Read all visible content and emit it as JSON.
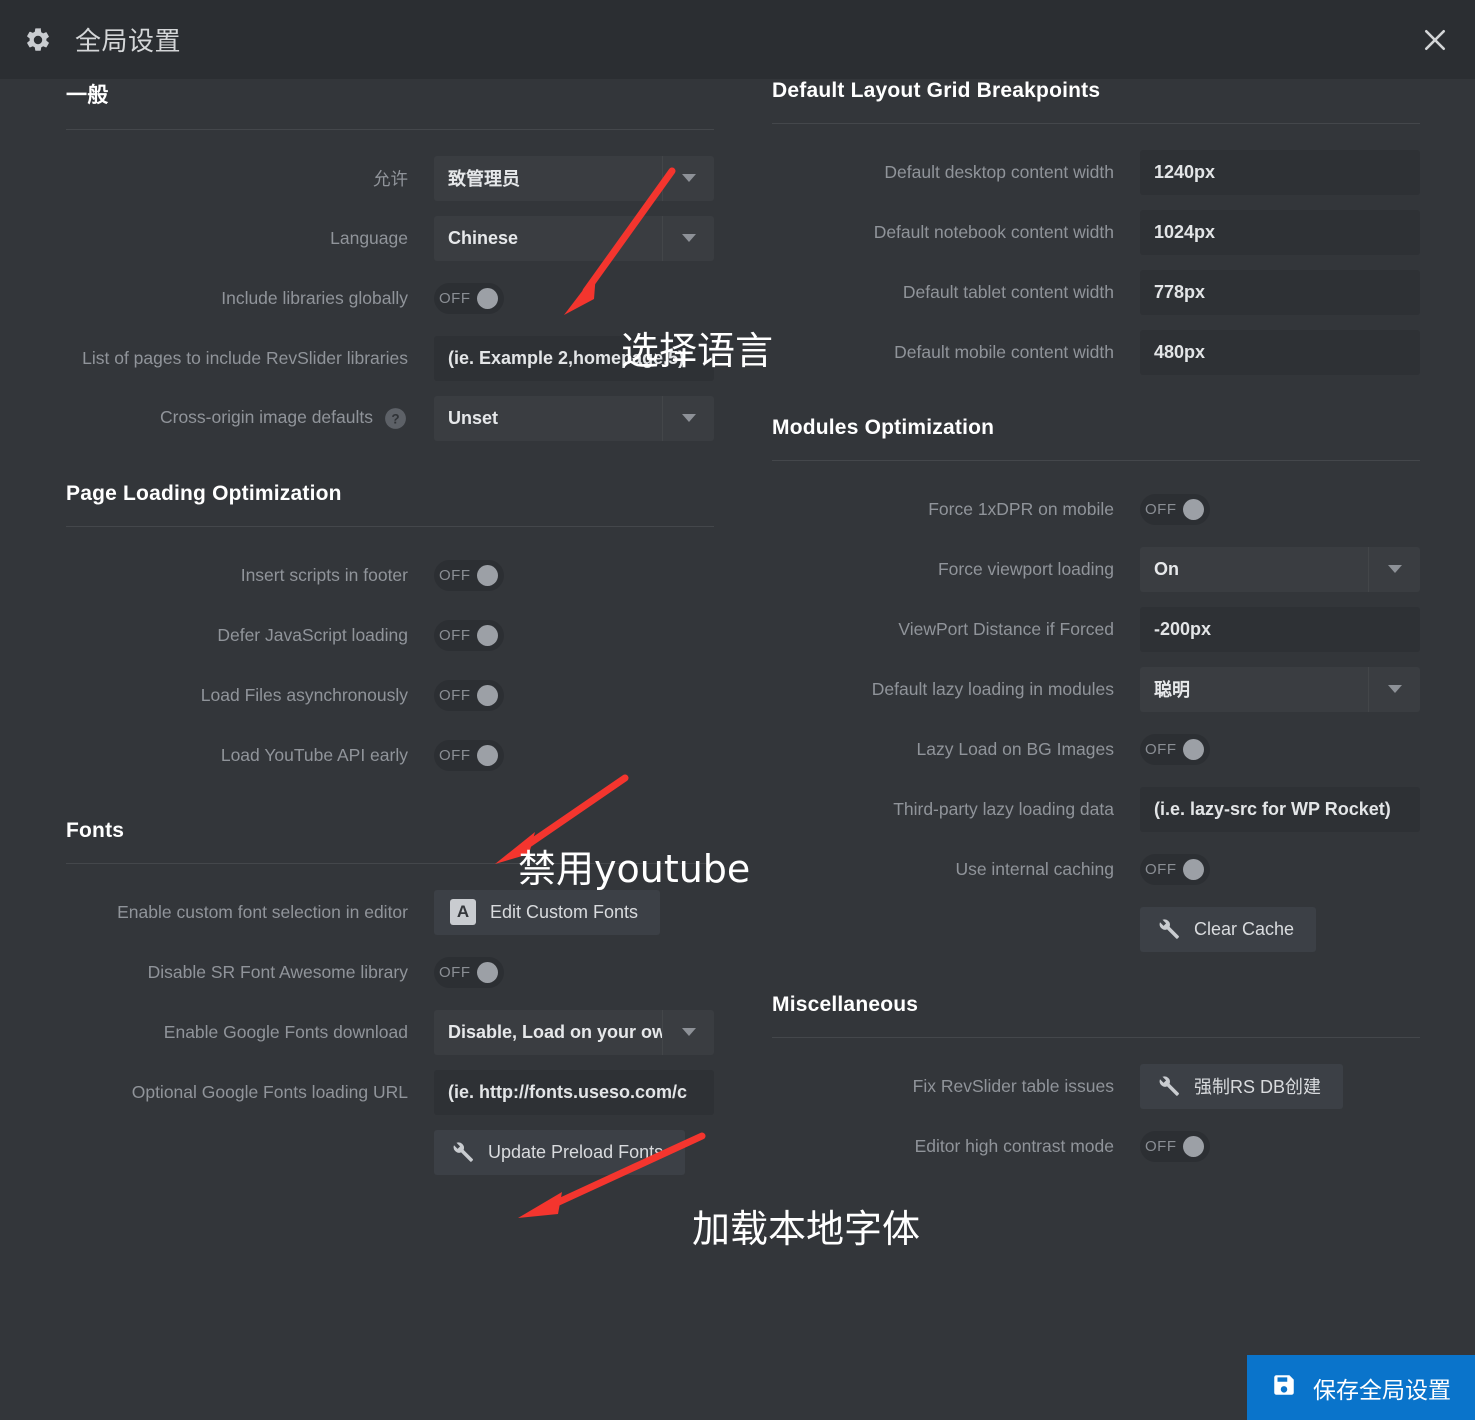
{
  "header": {
    "title": "全局设置",
    "gear_icon": "gear-icon",
    "close_icon": "close-icon"
  },
  "colors": {
    "accent": "#0a74cb",
    "annotation": "#f4352e",
    "panel_bg": "#33363a",
    "header_bg": "#2b2e32",
    "field_bg": "#2e3135",
    "select_bg": "#3a3d41"
  },
  "left_column": {
    "sections": [
      {
        "title": "一般",
        "rows": [
          {
            "label": "允许",
            "type": "select",
            "value": "致管理员"
          },
          {
            "label": "Language",
            "type": "select",
            "value": "Chinese"
          },
          {
            "label": "Include libraries globally",
            "type": "toggle",
            "value": "OFF"
          },
          {
            "label": "List of pages to include RevSlider libraries",
            "type": "input",
            "value": "(ie. Example 2,homepage,5)"
          },
          {
            "label": "Cross-origin image defaults",
            "type": "select",
            "value": "Unset",
            "help": "help-icon"
          }
        ]
      },
      {
        "title": "Page Loading Optimization",
        "rows": [
          {
            "label": "Insert scripts in footer",
            "type": "toggle",
            "value": "OFF"
          },
          {
            "label": "Defer JavaScript loading",
            "type": "toggle",
            "value": "OFF"
          },
          {
            "label": "Load Files asynchronously",
            "type": "toggle",
            "value": "OFF"
          },
          {
            "label": "Load YouTube API early",
            "type": "toggle",
            "value": "OFF"
          }
        ]
      },
      {
        "title": "Fonts",
        "rows": [
          {
            "label": "Enable custom font selection in editor",
            "type": "button",
            "value": "Edit Custom Fonts",
            "icon": "letter-a-icon"
          },
          {
            "label": "Disable SR Font Awesome library",
            "type": "toggle",
            "value": "OFF"
          },
          {
            "label": "Enable Google Fonts download",
            "type": "select",
            "value": "Disable, Load on your ow"
          },
          {
            "label": "Optional Google Fonts loading URL",
            "type": "input",
            "value": "(ie. http://fonts.useso.com/c"
          },
          {
            "label": "",
            "type": "button",
            "value": "Update Preload Fonts",
            "icon": "wrench-icon"
          }
        ]
      }
    ]
  },
  "right_column": {
    "sections": [
      {
        "title": "Default Layout Grid Breakpoints",
        "rows": [
          {
            "label": "Default desktop content width",
            "type": "input",
            "value": "1240px"
          },
          {
            "label": "Default notebook content width",
            "type": "input",
            "value": "1024px"
          },
          {
            "label": "Default tablet content width",
            "type": "input",
            "value": "778px"
          },
          {
            "label": "Default mobile content width",
            "type": "input",
            "value": "480px"
          }
        ]
      },
      {
        "title": "Modules Optimization",
        "rows": [
          {
            "label": "Force 1xDPR on mobile",
            "type": "toggle",
            "value": "OFF"
          },
          {
            "label": "Force viewport loading",
            "type": "select",
            "value": "On"
          },
          {
            "label": "ViewPort Distance if Forced",
            "type": "input",
            "value": "-200px"
          },
          {
            "label": "Default lazy loading in modules",
            "type": "select",
            "value": "聪明"
          },
          {
            "label": "Lazy Load on BG Images",
            "type": "toggle",
            "value": "OFF"
          },
          {
            "label": "Third-party lazy loading data",
            "type": "input",
            "value": "(i.e. lazy-src for WP Rocket)"
          },
          {
            "label": "Use internal caching",
            "type": "toggle",
            "value": "OFF"
          },
          {
            "label": "",
            "type": "button",
            "value": "Clear Cache",
            "icon": "wrench-icon"
          }
        ]
      },
      {
        "title": "Miscellaneous",
        "rows": [
          {
            "label": "Fix RevSlider table issues",
            "type": "button",
            "value": "强制RS DB创建",
            "icon": "wrench-icon"
          },
          {
            "label": "Editor high contrast mode",
            "type": "toggle",
            "value": "OFF"
          }
        ]
      }
    ]
  },
  "annotations": [
    {
      "text": "选择语言",
      "name": "annotation-select-language"
    },
    {
      "text": "禁用youtube",
      "name": "annotation-disable-youtube"
    },
    {
      "text": "加载本地字体",
      "name": "annotation-load-local-fonts"
    }
  ],
  "save_button": {
    "label": "保存全局设置",
    "icon": "save-disk-icon"
  }
}
